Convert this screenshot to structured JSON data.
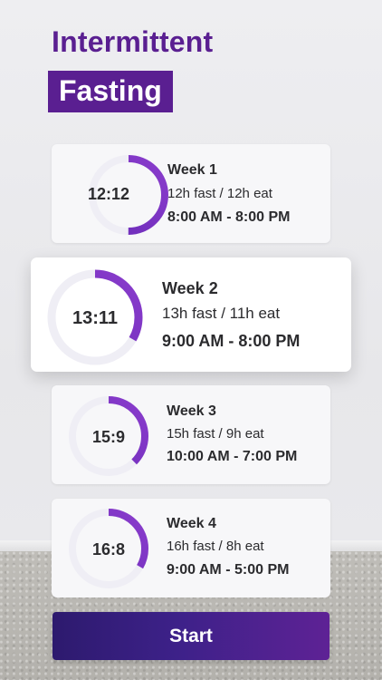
{
  "header": {
    "title_line1": "Intermittent",
    "title_line2": "Fasting"
  },
  "colors": {
    "accent": "#5a1f91",
    "ring_track": "#efeef5",
    "ring_gradient_start": "#6a2bb8",
    "ring_gradient_end": "#8a3ccc",
    "button_start": "#2d1a6e",
    "button_end": "#5e2295"
  },
  "plans": [
    {
      "ratio": "12:12",
      "week": "Week 1",
      "split": "12h fast / 12h eat",
      "window": "8:00 AM - 8:00 PM",
      "fast_fraction": 0.5
    },
    {
      "ratio": "13:11",
      "week": "Week 2",
      "split": "13h fast / 11h eat",
      "window": "9:00 AM - 8:00 PM",
      "fast_fraction": 0.3333
    },
    {
      "ratio": "15:9",
      "week": "Week 3",
      "split": "15h fast / 9h eat",
      "window": "10:00 AM - 7:00 PM",
      "fast_fraction": 0.375
    },
    {
      "ratio": "16:8",
      "week": "Week 4",
      "split": "16h fast / 8h eat",
      "window": "9:00 AM - 5:00 PM",
      "fast_fraction": 0.3333
    }
  ],
  "start_button": {
    "label": "Start"
  }
}
